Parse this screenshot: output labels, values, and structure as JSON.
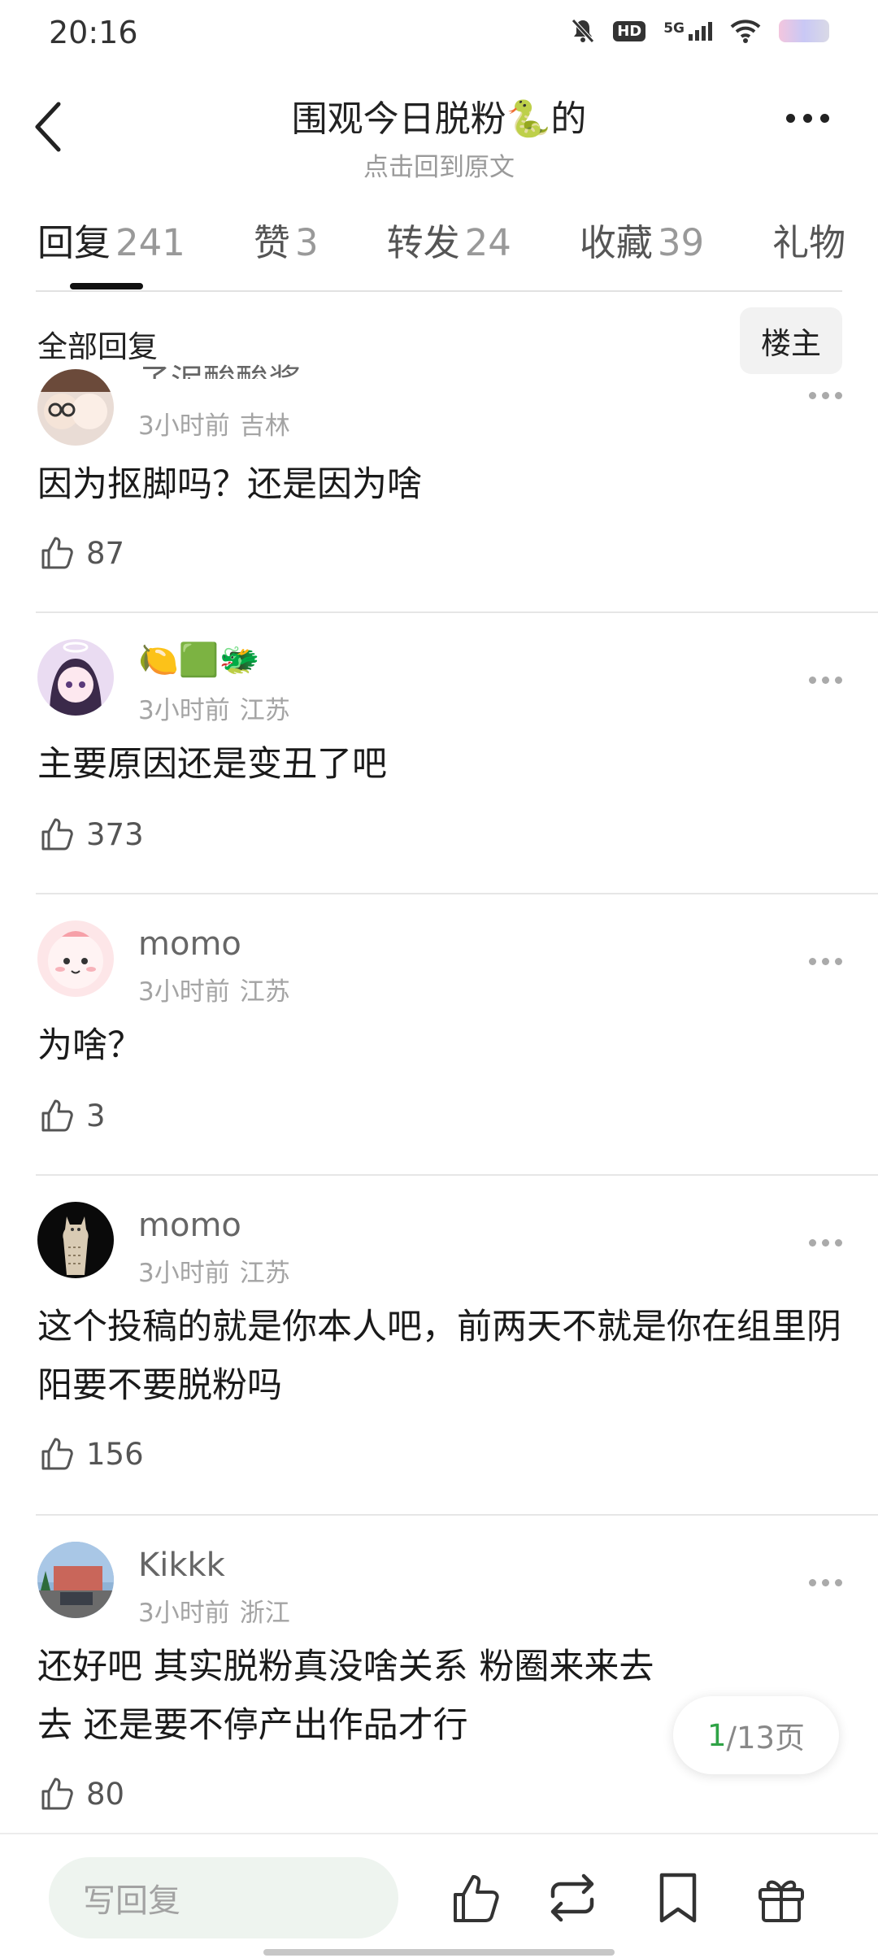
{
  "status_bar": {
    "time": "20:16",
    "hd": "HD",
    "network": "5G"
  },
  "header": {
    "title": "围观今日脱粉🐍的",
    "subtitle": "点击回到原文"
  },
  "tabs": [
    {
      "label": "回复",
      "count": "241"
    },
    {
      "label": "赞",
      "count": "3"
    },
    {
      "label": "转发",
      "count": "24"
    },
    {
      "label": "收藏",
      "count": "39"
    },
    {
      "label": "礼物",
      "count": ""
    }
  ],
  "filter": {
    "label": "全部回复",
    "op_button": "楼主"
  },
  "comments": [
    {
      "username": "子泥酸酸酱",
      "time": "3小时前",
      "region": "吉林",
      "text": "因为抠脚吗？还是因为啥",
      "likes": "87"
    },
    {
      "username": "🍋🟩🐲",
      "time": "3小时前",
      "region": "江苏",
      "text": "主要原因还是变丑了吧",
      "likes": "373"
    },
    {
      "username": "momo",
      "time": "3小时前",
      "region": "江苏",
      "text": "为啥？",
      "likes": "3"
    },
    {
      "username": "momo",
      "time": "3小时前",
      "region": "江苏",
      "text": "这个投稿的就是你本人吧，前两天不就是你在组里阴阳要不要脱粉吗",
      "likes": "156"
    },
    {
      "username": "Kikkk",
      "time": "3小时前",
      "region": "浙江",
      "text": "还好吧 其实脱粉真没啥关系 粉圈来来去去  还是要不停产出作品才行",
      "likes": "80"
    }
  ],
  "pagination": {
    "current": "1",
    "total": "/13页"
  },
  "bottom_bar": {
    "reply_placeholder": "写回复"
  },
  "colors": {
    "accent": "#2fa346",
    "reply_bg": "#eef4ef"
  },
  "icons": [
    "back-icon",
    "more-icon",
    "thumb-up-icon",
    "repost-icon",
    "bookmark-icon",
    "gift-icon"
  ]
}
